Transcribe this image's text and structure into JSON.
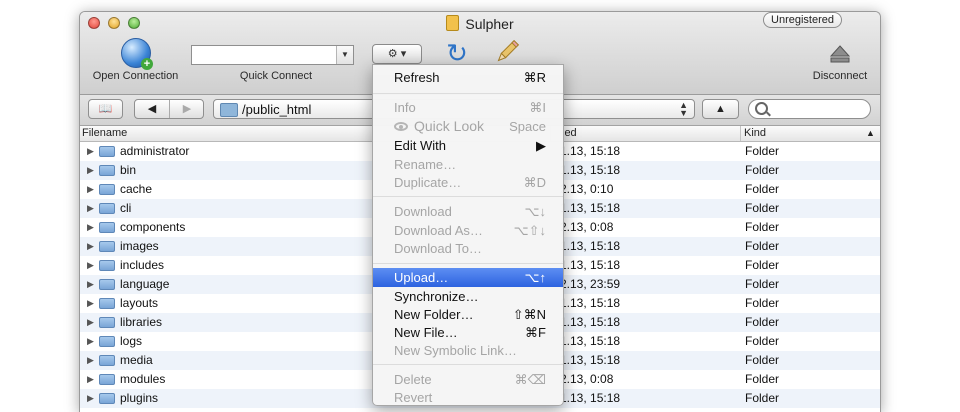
{
  "window": {
    "title": "Sulpher",
    "registration_badge": "Unregistered"
  },
  "toolbar": {
    "open_connection_label": "Open Connection",
    "quick_connect_label": "Quick Connect",
    "quick_connect_value": "",
    "action_gear": "⚙",
    "action_caret": "▾",
    "disconnect_label": "Disconnect",
    "combo_arrow": "▼"
  },
  "navbar": {
    "bookmarks_glyph": "📖",
    "back_glyph": "◀",
    "forward_glyph": "▶",
    "path": "/public_html",
    "up_glyph": "▲",
    "search_value": ""
  },
  "columns": {
    "filename": "Filename",
    "modified": "ied",
    "kind": "Kind",
    "sort_glyph": "▲"
  },
  "files": [
    {
      "name": "administrator",
      "modified": "1.13, 15:18",
      "kind": "Folder"
    },
    {
      "name": "bin",
      "modified": "1.13, 15:18",
      "kind": "Folder"
    },
    {
      "name": "cache",
      "modified": "2.13, 0:10",
      "kind": "Folder"
    },
    {
      "name": "cli",
      "modified": "1.13, 15:18",
      "kind": "Folder"
    },
    {
      "name": "components",
      "modified": "2.13, 0:08",
      "kind": "Folder"
    },
    {
      "name": "images",
      "modified": "1.13, 15:18",
      "kind": "Folder"
    },
    {
      "name": "includes",
      "modified": "1.13, 15:18",
      "kind": "Folder"
    },
    {
      "name": "language",
      "modified": "2.13, 23:59",
      "kind": "Folder"
    },
    {
      "name": "layouts",
      "modified": "1.13, 15:18",
      "kind": "Folder"
    },
    {
      "name": "libraries",
      "modified": "1.13, 15:18",
      "kind": "Folder"
    },
    {
      "name": "logs",
      "modified": "1.13, 15:18",
      "kind": "Folder"
    },
    {
      "name": "media",
      "modified": "1.13, 15:18",
      "kind": "Folder"
    },
    {
      "name": "modules",
      "modified": "2.13, 0:08",
      "kind": "Folder"
    },
    {
      "name": "plugins",
      "modified": "1.13, 15:18",
      "kind": "Folder"
    }
  ],
  "menu": {
    "items": [
      {
        "label": "Refresh",
        "shortcut": "⌘R",
        "enabled": true
      },
      {
        "label": "Info",
        "shortcut": "⌘I",
        "enabled": false
      },
      {
        "label": "Quick Look",
        "shortcut": "Space",
        "enabled": false
      },
      {
        "label": "Edit With",
        "shortcut": "▶",
        "enabled": true
      },
      {
        "label": "Rename…",
        "shortcut": "",
        "enabled": false
      },
      {
        "label": "Duplicate…",
        "shortcut": "⌘D",
        "enabled": false
      },
      {
        "label": "Download",
        "shortcut": "⌥↓",
        "enabled": false
      },
      {
        "label": "Download As…",
        "shortcut": "⌥⇧↓",
        "enabled": false
      },
      {
        "label": "Download To…",
        "shortcut": "",
        "enabled": false
      },
      {
        "label": "Upload…",
        "shortcut": "⌥↑",
        "enabled": true,
        "highlighted": true
      },
      {
        "label": "Synchronize…",
        "shortcut": "",
        "enabled": true
      },
      {
        "label": "New Folder…",
        "shortcut": "⇧⌘N",
        "enabled": true
      },
      {
        "label": "New File…",
        "shortcut": "⌘F",
        "enabled": true
      },
      {
        "label": "New Symbolic Link…",
        "shortcut": "",
        "enabled": false
      },
      {
        "label": "Delete",
        "shortcut": "⌘⌫",
        "enabled": false
      },
      {
        "label": "Revert",
        "shortcut": "",
        "enabled": false
      }
    ]
  },
  "colors": {
    "highlight": "#2d63e0",
    "alt_row": "#eef3fa",
    "disabled_text": "#a5a5a5"
  },
  "icons": {
    "open_connection": "globe-plus-icon",
    "refresh": "refresh-icon",
    "edit": "pencil-icon",
    "disconnect": "eject-icon",
    "folder": "folder-icon"
  }
}
